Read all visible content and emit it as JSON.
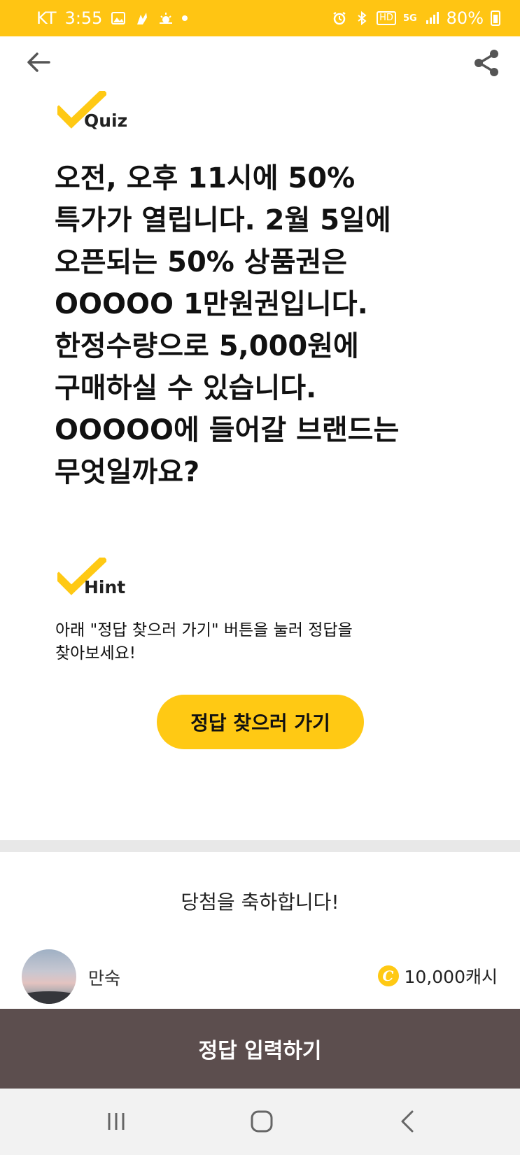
{
  "status_bar": {
    "carrier": "KT",
    "time": "3:55",
    "battery": "80%",
    "network": "5G",
    "hd_label": "HD"
  },
  "app_bar": {
    "back_icon": "arrow-left-icon",
    "share_icon": "share-icon"
  },
  "quiz": {
    "label": "Quiz",
    "question": "오전, 오후 11시에 50%\n특가가 열립니다. 2월 5일에\n오픈되는 50% 상품권은\nOOOOO 1만원권입니다.\n한정수량으로 5,000원에\n구매하실 수 있습니다.\nOOOOO에 들어갈 브랜드는\n무엇일까요?"
  },
  "hint": {
    "label": "Hint",
    "text": "아래 \"정답 찾으러 가기\" 버튼을 눌러 정답을\n찾아보세요!",
    "button_label": "정답 찾으러 가기"
  },
  "winners": {
    "title": "당첨을 축하합니다!",
    "items": [
      {
        "name": "만숙",
        "reward": "10,000캐시",
        "coin_symbol": "C"
      }
    ]
  },
  "submit": {
    "label": "정답 입력하기"
  },
  "colors": {
    "accent_yellow": "#FFC513",
    "button_yellow": "#FFC914",
    "submit_brown": "#5C4E4E",
    "divider_gray": "#E8E8E8"
  }
}
